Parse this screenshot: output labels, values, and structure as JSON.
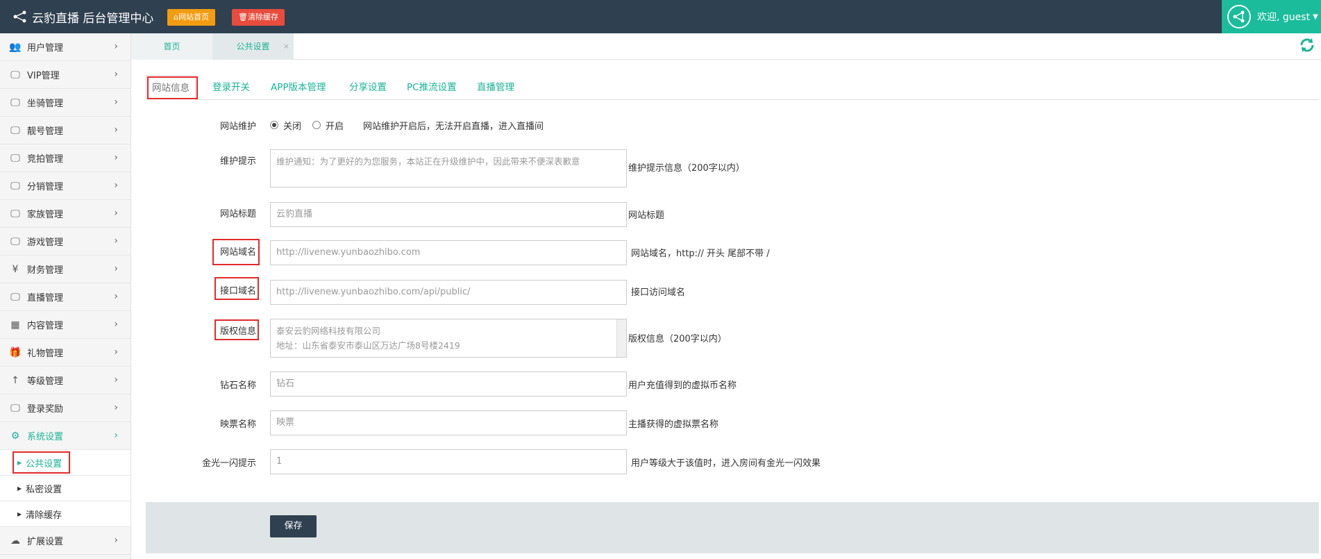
{
  "header": {
    "title": "云豹直播 后台管理中心",
    "home_button": "网站首页",
    "clear_cache_button": "清除缓存",
    "welcome": "欢迎, guest"
  },
  "sidebar": {
    "items": [
      {
        "label": "用户管理",
        "icon": "users-icon"
      },
      {
        "label": "VIP管理",
        "icon": "monitor-icon"
      },
      {
        "label": "坐骑管理",
        "icon": "monitor-icon"
      },
      {
        "label": "靓号管理",
        "icon": "monitor-icon"
      },
      {
        "label": "竞拍管理",
        "icon": "monitor-icon"
      },
      {
        "label": "分销管理",
        "icon": "monitor-icon"
      },
      {
        "label": "家族管理",
        "icon": "monitor-icon"
      },
      {
        "label": "游戏管理",
        "icon": "monitor-icon"
      },
      {
        "label": "财务管理",
        "icon": "yen-icon"
      },
      {
        "label": "直播管理",
        "icon": "monitor-icon"
      },
      {
        "label": "内容管理",
        "icon": "grid-icon"
      },
      {
        "label": "礼物管理",
        "icon": "gift-icon"
      },
      {
        "label": "等级管理",
        "icon": "arrow-up-icon"
      },
      {
        "label": "登录奖励",
        "icon": "monitor-icon"
      },
      {
        "label": "系统设置",
        "icon": "gears-icon"
      }
    ],
    "sub_items": [
      {
        "label": "公共设置"
      },
      {
        "label": "私密设置"
      },
      {
        "label": "清除缓存"
      }
    ],
    "last_item": {
      "label": "扩展设置",
      "icon": "cloud-icon"
    }
  },
  "tabs": {
    "home": "首页",
    "current": "公共设置",
    "close": "×"
  },
  "subtabs": [
    "网站信息",
    "登录开关",
    "APP版本管理",
    "分享设置",
    "PC推流设置",
    "直播管理"
  ],
  "form": {
    "maintenance": {
      "label": "网站维护",
      "off": "关闭",
      "on": "开启",
      "hint": "网站维护开启后，无法开启直播，进入直播间"
    },
    "maintenance_tip": {
      "label": "维护提示",
      "placeholder": "维护通知：为了更好的为您服务，本站正在升级维护中，因此带来不便深表歉意",
      "hint": "维护提示信息（200字以内）"
    },
    "site_title": {
      "label": "网站标题",
      "value": "云豹直播",
      "hint": "网站标题"
    },
    "site_domain": {
      "label": "网站域名",
      "value": "http://livenew.yunbaozhibo.com",
      "hint": "网站域名，http:// 开头 尾部不带 /"
    },
    "api_domain": {
      "label": "接口域名",
      "value": "http://livenew.yunbaozhibo.com/api/public/",
      "hint": "接口访问域名"
    },
    "copyright": {
      "label": "版权信息",
      "line1": "泰安云豹网络科技有限公司",
      "line2": "地址：山东省泰安市泰山区万达广场8号楼2419",
      "hint": "版权信息（200字以内）"
    },
    "diamond": {
      "label": "钻石名称",
      "value": "钻石",
      "hint": "用户充值得到的虚拟币名称"
    },
    "ticket": {
      "label": "映票名称",
      "value": "映票",
      "hint": "主播获得的虚拟票名称"
    },
    "flash": {
      "label": "金光一闪提示",
      "value": "1",
      "hint": "用户等级大于该值时，进入房间有金光一闪效果"
    }
  },
  "save_button": "保存",
  "colors": {
    "header": "#2f4050",
    "accent": "#1ab394",
    "highlight": "#e32a2a"
  }
}
